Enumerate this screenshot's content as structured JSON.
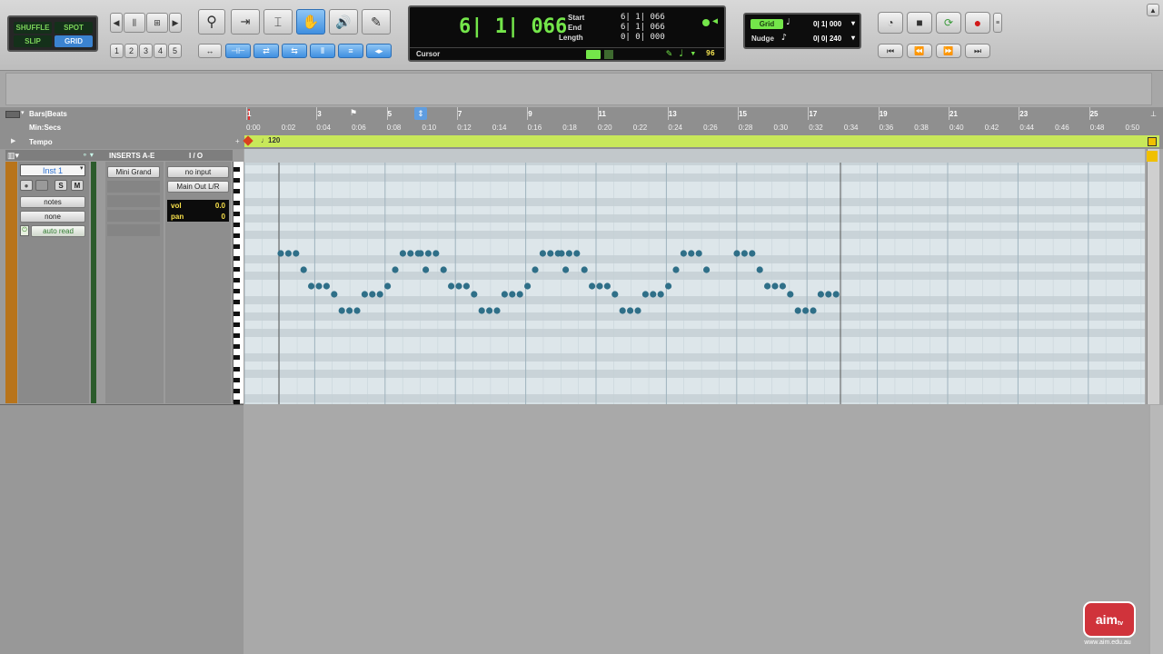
{
  "edit_modes": {
    "shuffle": "SHUFFLE",
    "spot": "SPOT",
    "slip": "SLIP",
    "grid": "GRID"
  },
  "zoom_presets": [
    "1",
    "2",
    "3",
    "4",
    "5"
  ],
  "counter": {
    "main": "6| 1| 066",
    "start_label": "Start",
    "start": "6| 1| 066",
    "end_label": "End",
    "end": "6| 1| 066",
    "length_label": "Length",
    "length": "0| 0| 000",
    "cursor_label": "Cursor",
    "velocity": "96"
  },
  "grid": {
    "grid_label": "Grid",
    "grid_value": "0| 1| 000",
    "nudge_label": "Nudge",
    "nudge_value": "0| 0| 240"
  },
  "rulers": {
    "bars_beats_label": "Bars|Beats",
    "min_secs_label": "Min:Secs",
    "tempo_label": "Tempo",
    "tempo_value": "120",
    "bars": [
      "1",
      "3",
      "5",
      "7",
      "9",
      "11",
      "13",
      "15",
      "17",
      "19",
      "21",
      "23",
      "25"
    ],
    "times": [
      "0:00",
      "0:02",
      "0:04",
      "0:06",
      "0:08",
      "0:10",
      "0:12",
      "0:14",
      "0:16",
      "0:18",
      "0:20",
      "0:22",
      "0:24",
      "0:26",
      "0:28",
      "0:30",
      "0:32",
      "0:34",
      "0:36",
      "0:38",
      "0:40",
      "0:42",
      "0:44",
      "0:46",
      "0:48",
      "0:50"
    ]
  },
  "track": {
    "inserts_header": "INSERTS A-E",
    "io_header": "I / O",
    "name": "Inst 1",
    "solo": "S",
    "mute": "M",
    "view": "notes",
    "playlist": "none",
    "automation": "auto read",
    "insert_1": "Mini Grand",
    "input": "no input",
    "output": "Main Out L/R",
    "vol_label": "vol",
    "vol_value": "0.0",
    "pan_label": "pan",
    "pan_value": "0"
  },
  "watermark": {
    "logo": "aim tv",
    "url": "www.aim.edu.au"
  },
  "colors": {
    "tempo_ruler": "#c8e85a",
    "counter_text": "#74e64a",
    "track_color": "#b8741b",
    "notes": "#2f6f88"
  }
}
